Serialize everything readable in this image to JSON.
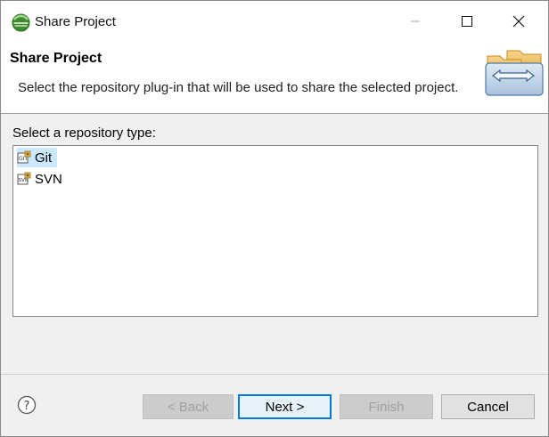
{
  "window": {
    "title": "Share Project"
  },
  "header": {
    "title": "Share Project",
    "description": "Select the repository plug-in that will be used to share the selected project."
  },
  "repository": {
    "label": "Select a repository type:",
    "items": [
      {
        "label": "Git",
        "icon": "git-repo-icon",
        "selected": true
      },
      {
        "label": "SVN",
        "icon": "svn-repo-icon",
        "selected": false
      }
    ]
  },
  "buttons": {
    "back": "< Back",
    "next": "Next >",
    "finish": "Finish",
    "cancel": "Cancel"
  },
  "colors": {
    "selection": "#cce8ff",
    "default_button_border": "#0078d7"
  }
}
